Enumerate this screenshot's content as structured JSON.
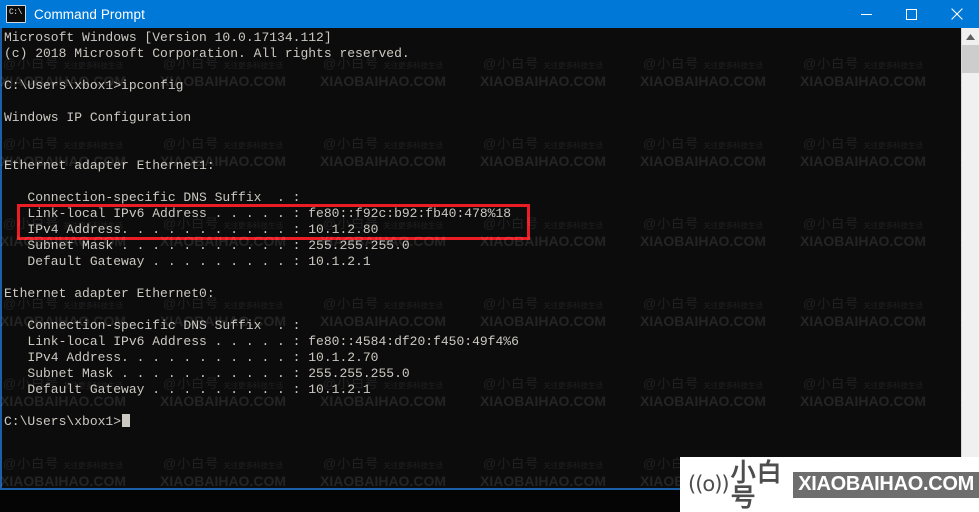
{
  "window": {
    "title": "Command Prompt",
    "icon_name": "command-prompt-icon",
    "icon_glyph": "C:\\",
    "accent_color": "#0078d7",
    "console_bg": "#0c0c0c",
    "console_fg": "#ccc9c2"
  },
  "window_controls": {
    "minimize_label": "Minimize",
    "maximize_label": "Maximize",
    "close_label": "Close"
  },
  "console": {
    "lines": [
      "Microsoft Windows [Version 10.0.17134.112]",
      "(c) 2018 Microsoft Corporation. All rights reserved.",
      "",
      "C:\\Users\\xbox1>ipconfig",
      "",
      "Windows IP Configuration",
      "",
      "",
      "Ethernet adapter Ethernet1:",
      "",
      "   Connection-specific DNS Suffix  . :",
      "   Link-local IPv6 Address . . . . . : fe80::f92c:b92:fb40:478%18",
      "   IPv4 Address. . . . . . . . . . . : 10.1.2.80",
      "   Subnet Mask . . . . . . . . . . . : 255.255.255.0",
      "   Default Gateway . . . . . . . . . : 10.1.2.1",
      "",
      "Ethernet adapter Ethernet0:",
      "",
      "   Connection-specific DNS Suffix  . :",
      "   Link-local IPv6 Address . . . . . : fe80::4584:df20:f450:49f4%6",
      "   IPv4 Address. . . . . . . . . . . : 10.1.2.70",
      "   Subnet Mask . . . . . . . . . . . : 255.255.255.0",
      "   Default Gateway . . . . . . . . . : 10.1.2.1",
      ""
    ],
    "prompt": "C:\\Users\\xbox1>",
    "command_entered": "ipconfig"
  },
  "highlight": {
    "color": "#ec1c24",
    "note": "red rectangle around Link-local IPv6 Address and IPv4 Address lines of Ethernet1"
  },
  "scrollbar": {
    "up_arrow": "▲",
    "down_arrow": "▼"
  },
  "watermark": {
    "cn": "@小白号",
    "cn_sub": "关注更多科技生活",
    "en": "XIAOBAIHAO.COM"
  },
  "badge": {
    "wave_icon": "((o))",
    "cn": "小白号",
    "en": "XIAOBAIHAO.COM",
    "bg": "#ffffff",
    "en_bg": "#6e6e6e"
  }
}
